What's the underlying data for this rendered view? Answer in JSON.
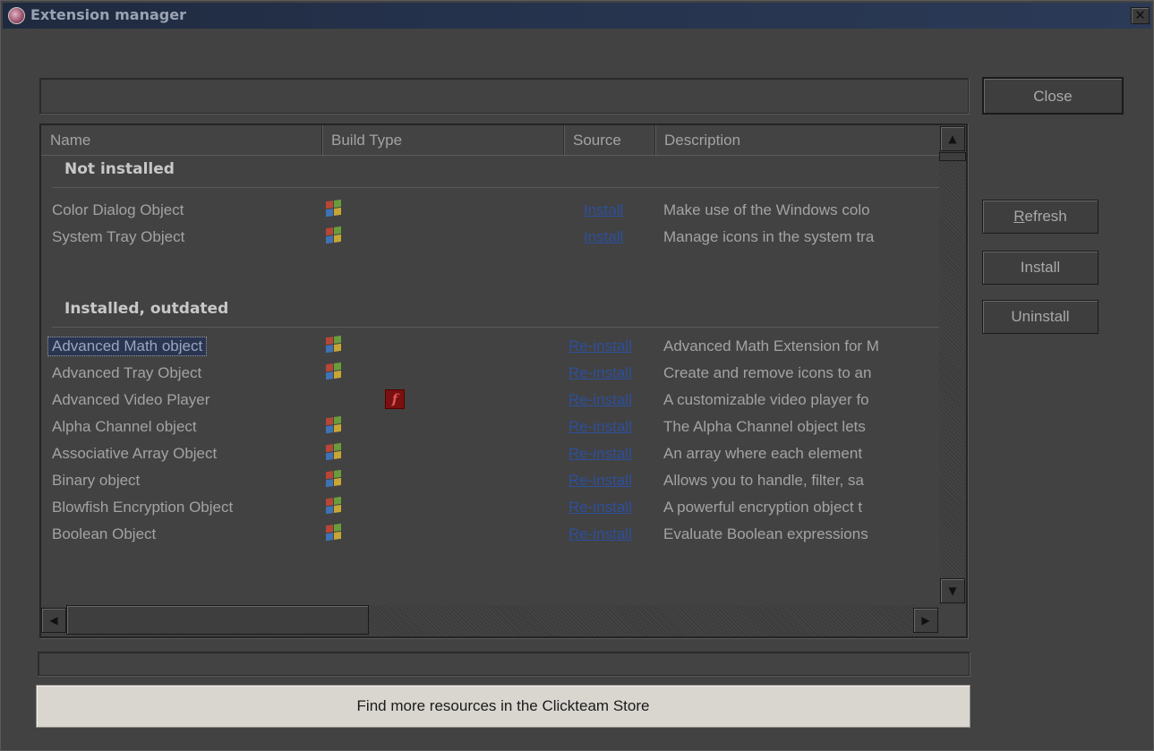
{
  "window": {
    "title": "Extension manager",
    "close_glyph": "✕"
  },
  "path_field": {
    "value": ""
  },
  "buttons": {
    "close": "Close",
    "refresh_mnemonic": "R",
    "refresh_rest": "efresh",
    "install": "Install",
    "uninstall": "Uninstall"
  },
  "list": {
    "columns": [
      "Name",
      "Build Type",
      "Source",
      "Description"
    ],
    "groups": [
      {
        "label": "Not installed",
        "rows": [
          {
            "name": "Color Dialog Object",
            "build_icon": "windows-icon",
            "source": "Install",
            "description": "Make use of the Windows colo"
          },
          {
            "name": "System Tray Object",
            "build_icon": "windows-icon",
            "source": "Install",
            "description": "Manage icons in the system tra"
          }
        ]
      },
      {
        "label": "Installed, outdated",
        "rows": [
          {
            "name": "Advanced Math object",
            "build_icon": "windows-icon",
            "source": "Re-install",
            "description": "Advanced Math Extension for M",
            "selected": true
          },
          {
            "name": "Advanced Tray Object",
            "build_icon": "windows-icon",
            "source": "Re-install",
            "description": "Create and remove icons to an"
          },
          {
            "name": "Advanced Video Player",
            "build_icon": "flash-icon",
            "source": "Re-install",
            "description": "A customizable video player fo"
          },
          {
            "name": "Alpha Channel object",
            "build_icon": "windows-icon",
            "source": "Re-install",
            "description": "The Alpha Channel object lets"
          },
          {
            "name": "Associative Array Object",
            "build_icon": "windows-icon",
            "source": "Re-install",
            "description": "An array where each element"
          },
          {
            "name": "Binary object",
            "build_icon": "windows-icon",
            "source": "Re-install",
            "description": "Allows you to handle, filter, sa"
          },
          {
            "name": "Blowfish Encryption Object",
            "build_icon": "windows-icon",
            "source": "Re-install",
            "description": "A powerful encryption object t"
          },
          {
            "name": "Boolean Object",
            "build_icon": "windows-icon",
            "source": "Re-install",
            "description": "Evaluate Boolean expressions"
          }
        ]
      }
    ]
  },
  "store_button": "Find more resources in the Clickteam Store",
  "colors": {
    "link": "#2d4f9c",
    "selection": "#2a3552",
    "titlebar": "#25324c"
  }
}
